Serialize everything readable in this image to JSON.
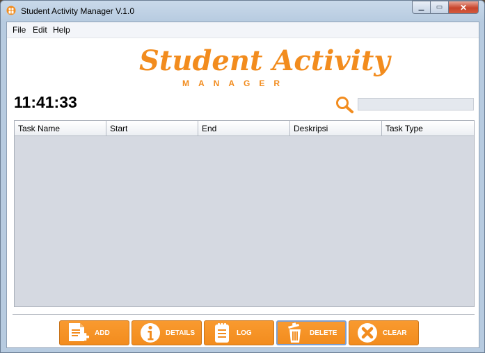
{
  "window": {
    "title": "Student Activity Manager V.1.0"
  },
  "menu": [
    "File",
    "Edit",
    "Help"
  ],
  "logo": {
    "main": "Student Activity",
    "sub": "MANAGER"
  },
  "clock": "11:41:33",
  "search": {
    "placeholder": ""
  },
  "table": {
    "columns": [
      "Task Name",
      "Start",
      "End",
      "Deskripsi",
      "Task Type"
    ],
    "rows": []
  },
  "buttons": {
    "add": "ADD",
    "details": "DETAILS",
    "log": "LOG",
    "delete": "DELETE",
    "clear": "CLEAR"
  },
  "colors": {
    "accent": "#f28c1e",
    "table_bg": "#d5d9e1"
  }
}
